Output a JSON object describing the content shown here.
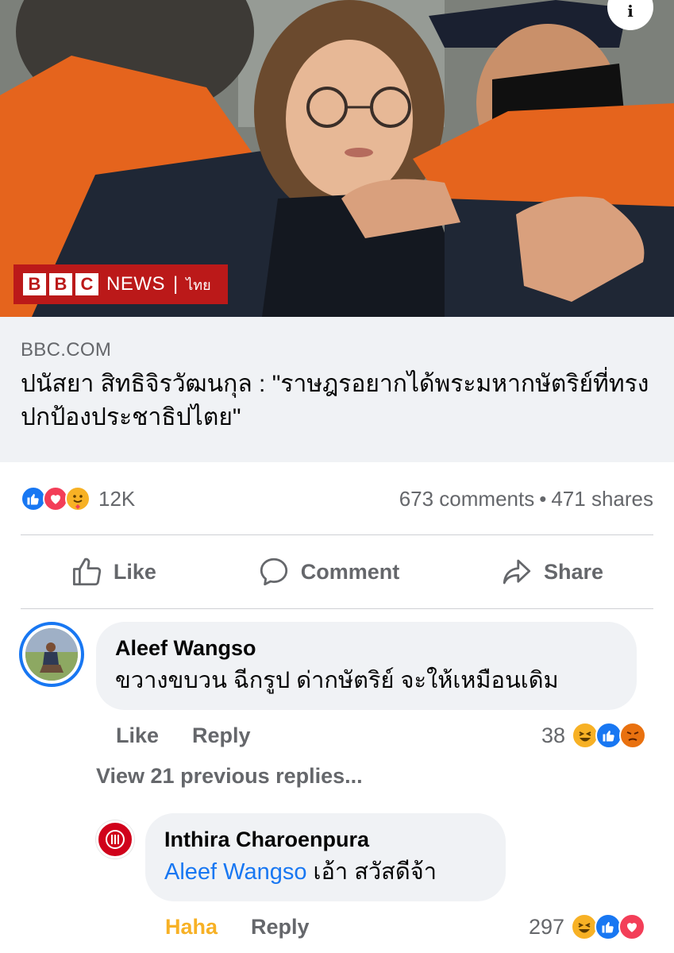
{
  "hero": {
    "bbc_blocks": [
      "B",
      "B",
      "C"
    ],
    "bbc_news": "NEWS",
    "bbc_lang": "ไทย",
    "info_glyph": "i"
  },
  "link": {
    "domain": "BBC.COM",
    "title": "ปนัสยา สิทธิจิรวัฒนกุล : \"ราษฎรอยากได้พระมหากษัตริย์ที่ทรงปกป้องประชาธิปไตย\""
  },
  "stats": {
    "reaction_icons": [
      "like-icon",
      "love-icon",
      "care-icon"
    ],
    "reaction_count": "12K",
    "comments": "673 comments",
    "separator": "•",
    "shares": "471 shares"
  },
  "actions": {
    "like": "Like",
    "comment": "Comment",
    "share": "Share"
  },
  "comments": [
    {
      "author": "Aleef Wangso",
      "text": "ขวางขบวน ฉีกรูป ด่ากษัตริย์ จะให้เหมือนเดิม",
      "like_label": "Like",
      "reply_label": "Reply",
      "reaction_count": "38",
      "reaction_icons": [
        "haha-icon",
        "like-icon",
        "angry-icon"
      ]
    }
  ],
  "view_replies": "View 21 previous replies...",
  "replies": [
    {
      "author": "Inthira Charoenpura",
      "mention": "Aleef Wangso",
      "text": " เอ้า สวัสดีจ้า",
      "like_label": "Haha",
      "reply_label": "Reply",
      "reaction_count": "297",
      "reaction_icons": [
        "haha-icon",
        "like-icon",
        "love-icon"
      ]
    }
  ],
  "colors": {
    "facebook_blue": "#1877f2",
    "bbc_red": "#bb1919",
    "haha_yellow": "#f7b125",
    "love_red": "#f33e58",
    "angry_orange": "#e9710f",
    "muted_text": "#65676b"
  }
}
